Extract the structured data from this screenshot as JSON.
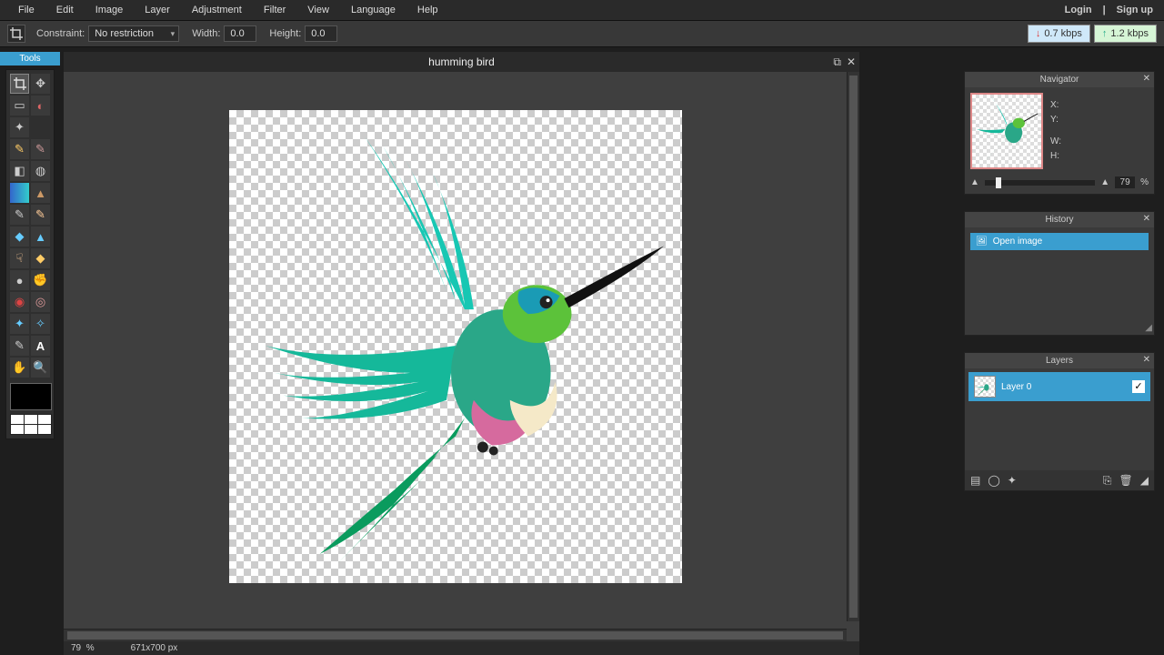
{
  "menu": {
    "items": [
      "File",
      "Edit",
      "Image",
      "Layer",
      "Adjustment",
      "Filter",
      "View",
      "Language",
      "Help"
    ],
    "login": "Login",
    "signup": "Sign up",
    "sep": "|"
  },
  "options": {
    "constraint_label": "Constraint:",
    "constraint_value": "No restriction",
    "width_label": "Width:",
    "width_value": "0.0",
    "height_label": "Height:",
    "height_value": "0.0"
  },
  "net": {
    "down": "0.7 kbps",
    "up": "1.2 kbps"
  },
  "tools_title": "Tools",
  "document": {
    "title": "humming bird",
    "dimensions": "671x700 px"
  },
  "status": {
    "zoom": "79",
    "pct": "%"
  },
  "navigator": {
    "title": "Navigator",
    "x_label": "X:",
    "y_label": "Y:",
    "w_label": "W:",
    "h_label": "H:",
    "zoom": "79",
    "pct": "%"
  },
  "history": {
    "title": "History",
    "items": [
      "Open image"
    ]
  },
  "layers": {
    "title": "Layers",
    "items": [
      {
        "name": "Layer 0",
        "visible": true
      }
    ]
  }
}
